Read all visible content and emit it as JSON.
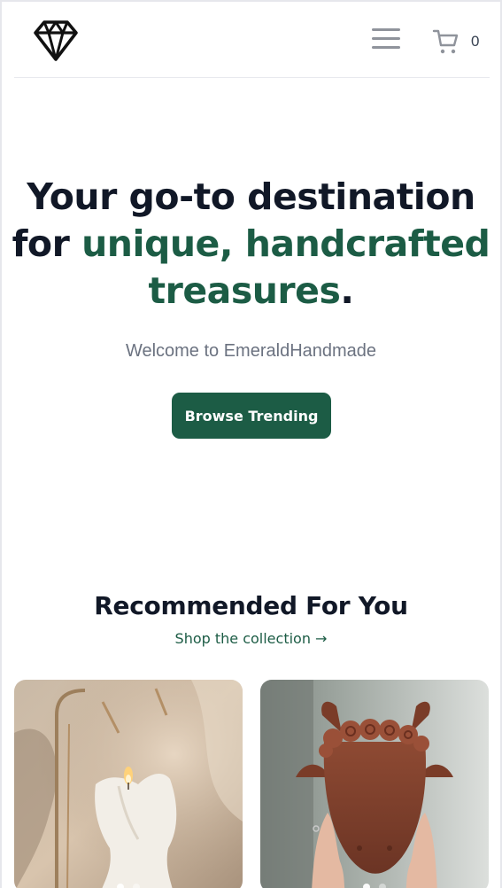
{
  "header": {
    "logo_icon": "diamond-icon",
    "menu_icon": "hamburger-menu-icon",
    "cart_icon": "shopping-cart-icon",
    "cart_count": "0"
  },
  "hero": {
    "title_part1": "Your go-to destination for ",
    "title_accent": "unique, handcrafted treasures",
    "title_end": ".",
    "subtitle": "Welcome to EmeraldHandmade",
    "button_label": "Browse Trending"
  },
  "recommended": {
    "title": "Recommended For You",
    "link_label": "Shop the collection →"
  },
  "colors": {
    "brand_green": "#1c5c45",
    "text_dark": "#111827",
    "text_muted": "#6b7280"
  }
}
